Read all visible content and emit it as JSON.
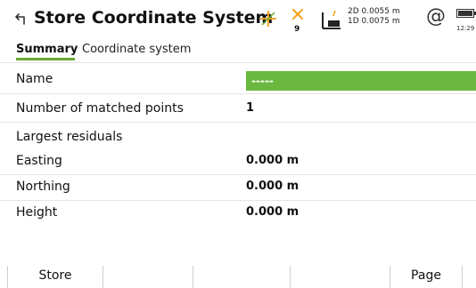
{
  "header": {
    "title": "Store Coordinate System",
    "back_icon": "back-arrow-icon",
    "satellite_count": "9",
    "precision_2d": "2D 0.0055 m",
    "precision_1d": "1D 0.0075 m",
    "at_symbol": "@",
    "clock": "12:29"
  },
  "tabs": [
    {
      "label": "Summary",
      "active": true
    },
    {
      "label": "Coordinate system",
      "active": false
    }
  ],
  "fields": {
    "name": {
      "label": "Name",
      "value": "-----"
    },
    "matched": {
      "label": "Number of matched points",
      "value": "1"
    },
    "residuals_heading": "Largest residuals",
    "easting": {
      "label": "Easting",
      "value": "0.000 m"
    },
    "northing": {
      "label": "Northing",
      "value": "0.000 m"
    },
    "height": {
      "label": "Height",
      "value": "0.000 m"
    }
  },
  "softkeys": {
    "store": "Store",
    "page": "Page"
  },
  "colors": {
    "accent": "#6aa832",
    "name_field_bg": "#6ab83f",
    "gps_orange": "#f5a623"
  }
}
